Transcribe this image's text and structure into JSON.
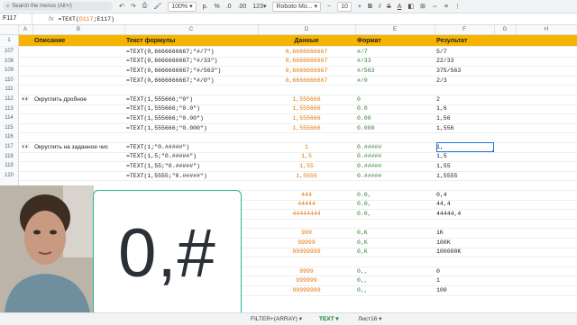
{
  "toolbar": {
    "search_placeholder": "Search the menus (Alt+/)",
    "zoom": "100%",
    "currency": "р.",
    "percent": "%",
    "dec_less": ".0",
    "dec_more": ".00",
    "format_more": "123",
    "font": "Roboto Mo...",
    "font_size": "10",
    "bold": "B",
    "italic": "I",
    "strike": "S",
    "text_color": "A"
  },
  "formula_bar": {
    "cell": "F117",
    "fx": "fx",
    "formula_prefix": "=TEXT(",
    "formula_ref": "D117",
    "formula_suffix": ";E117)"
  },
  "columns": [
    "A",
    "B",
    "C",
    "D",
    "E",
    "F",
    "G",
    "H"
  ],
  "header_row": {
    "num": "1",
    "desc": "Описание",
    "formula": "Текст формулы",
    "data": "Данные",
    "format": "Формат",
    "result": "Результат"
  },
  "rows": [
    {
      "num": "107",
      "desc": "",
      "formula": "=TEXT(0,6666666667;\"#/7\")",
      "data": "0,6666666667",
      "format": "#/7",
      "result": "5/7"
    },
    {
      "num": "108",
      "desc": "",
      "formula": "=TEXT(0,6666666667;\"#/33\")",
      "data": "0,6666666667",
      "format": "#/33",
      "result": "22/33"
    },
    {
      "num": "109",
      "desc": "",
      "formula": "=TEXT(0,6666666667;\"#/563\")",
      "data": "0,6666666667",
      "format": "#/563",
      "result": "375/563"
    },
    {
      "num": "110",
      "desc": "",
      "formula": "=TEXT(0,6666666667;\"#/0\")",
      "data": "0,6666666667",
      "format": "#/0",
      "result": "2/3"
    },
    {
      "num": "111",
      "desc": "",
      "formula": "",
      "data": "",
      "format": "",
      "result": ""
    },
    {
      "num": "112",
      "desc": "Округлить дробное",
      "formula": "=TEXT(1,555666;\"0\")",
      "data": "1,555666",
      "format": "0",
      "result": "2"
    },
    {
      "num": "113",
      "desc": "",
      "formula": "=TEXT(1,555666;\"0.0\")",
      "data": "1,555666",
      "format": "0.0",
      "result": "1,6"
    },
    {
      "num": "114",
      "desc": "",
      "formula": "=TEXT(1,555666;\"0.00\")",
      "data": "1,555666",
      "format": "0.00",
      "result": "1,56"
    },
    {
      "num": "115",
      "desc": "",
      "formula": "=TEXT(1,555666;\"0.000\")",
      "data": "1,555666",
      "format": "0.000",
      "result": "1,556"
    },
    {
      "num": "116",
      "desc": "",
      "formula": "",
      "data": "",
      "format": "",
      "result": ""
    },
    {
      "num": "117",
      "desc": "Округлить на заданное чис",
      "formula": "=TEXT(1;\"0.#####\")",
      "data": "1",
      "format": "0.#####",
      "result": "1,"
    },
    {
      "num": "118",
      "desc": "",
      "formula": "=TEXT(1,5;\"0.#####\")",
      "data": "1,5",
      "format": "0.#####",
      "result": "1,5"
    },
    {
      "num": "119",
      "desc": "",
      "formula": "=TEXT(1,55;\"0.#####\")",
      "data": "1,55",
      "format": "0.#####",
      "result": "1,55"
    },
    {
      "num": "120",
      "desc": "",
      "formula": "=TEXT(1,5555;\"0.#####\")",
      "data": "1,5555",
      "format": "0.#####",
      "result": "1,5555"
    },
    {
      "num": "",
      "desc": "",
      "formula": "",
      "data": "",
      "format": "",
      "result": ""
    },
    {
      "num": "",
      "desc": "",
      "formula": "",
      "data": "444",
      "format": "0.0,",
      "result": "0,4"
    },
    {
      "num": "",
      "desc": "",
      "formula": "",
      "data": "44444",
      "format": "0.0,",
      "result": "44,4"
    },
    {
      "num": "",
      "desc": "",
      "formula": "",
      "data": "44444444",
      "format": "0.0,",
      "result": "44444,4"
    },
    {
      "num": "",
      "desc": "",
      "formula": "",
      "data": "",
      "format": "",
      "result": ""
    },
    {
      "num": "",
      "desc": "",
      "formula": "",
      "data": "999",
      "format": "0,K",
      "result": "1K"
    },
    {
      "num": "",
      "desc": "",
      "formula": "",
      "data": "99999",
      "format": "0,K",
      "result": "100K"
    },
    {
      "num": "",
      "desc": "",
      "formula": "",
      "data": "99999999",
      "format": "0,K",
      "result": "100000K"
    },
    {
      "num": "",
      "desc": "",
      "formula": "",
      "data": "",
      "format": "",
      "result": ""
    },
    {
      "num": "",
      "desc": "",
      "formula": "",
      "data": "9999",
      "format": "0,,",
      "result": "0"
    },
    {
      "num": "",
      "desc": "",
      "formula": "",
      "data": "999999",
      "format": "0,,",
      "result": "1"
    },
    {
      "num": "",
      "desc": "",
      "formula": "",
      "data": "99999999",
      "format": "0,,",
      "result": "100"
    }
  ],
  "tabs": [
    "FILTER+(ARRAY)",
    "TEXT",
    "Лист16"
  ],
  "overlay_text": "0,#"
}
